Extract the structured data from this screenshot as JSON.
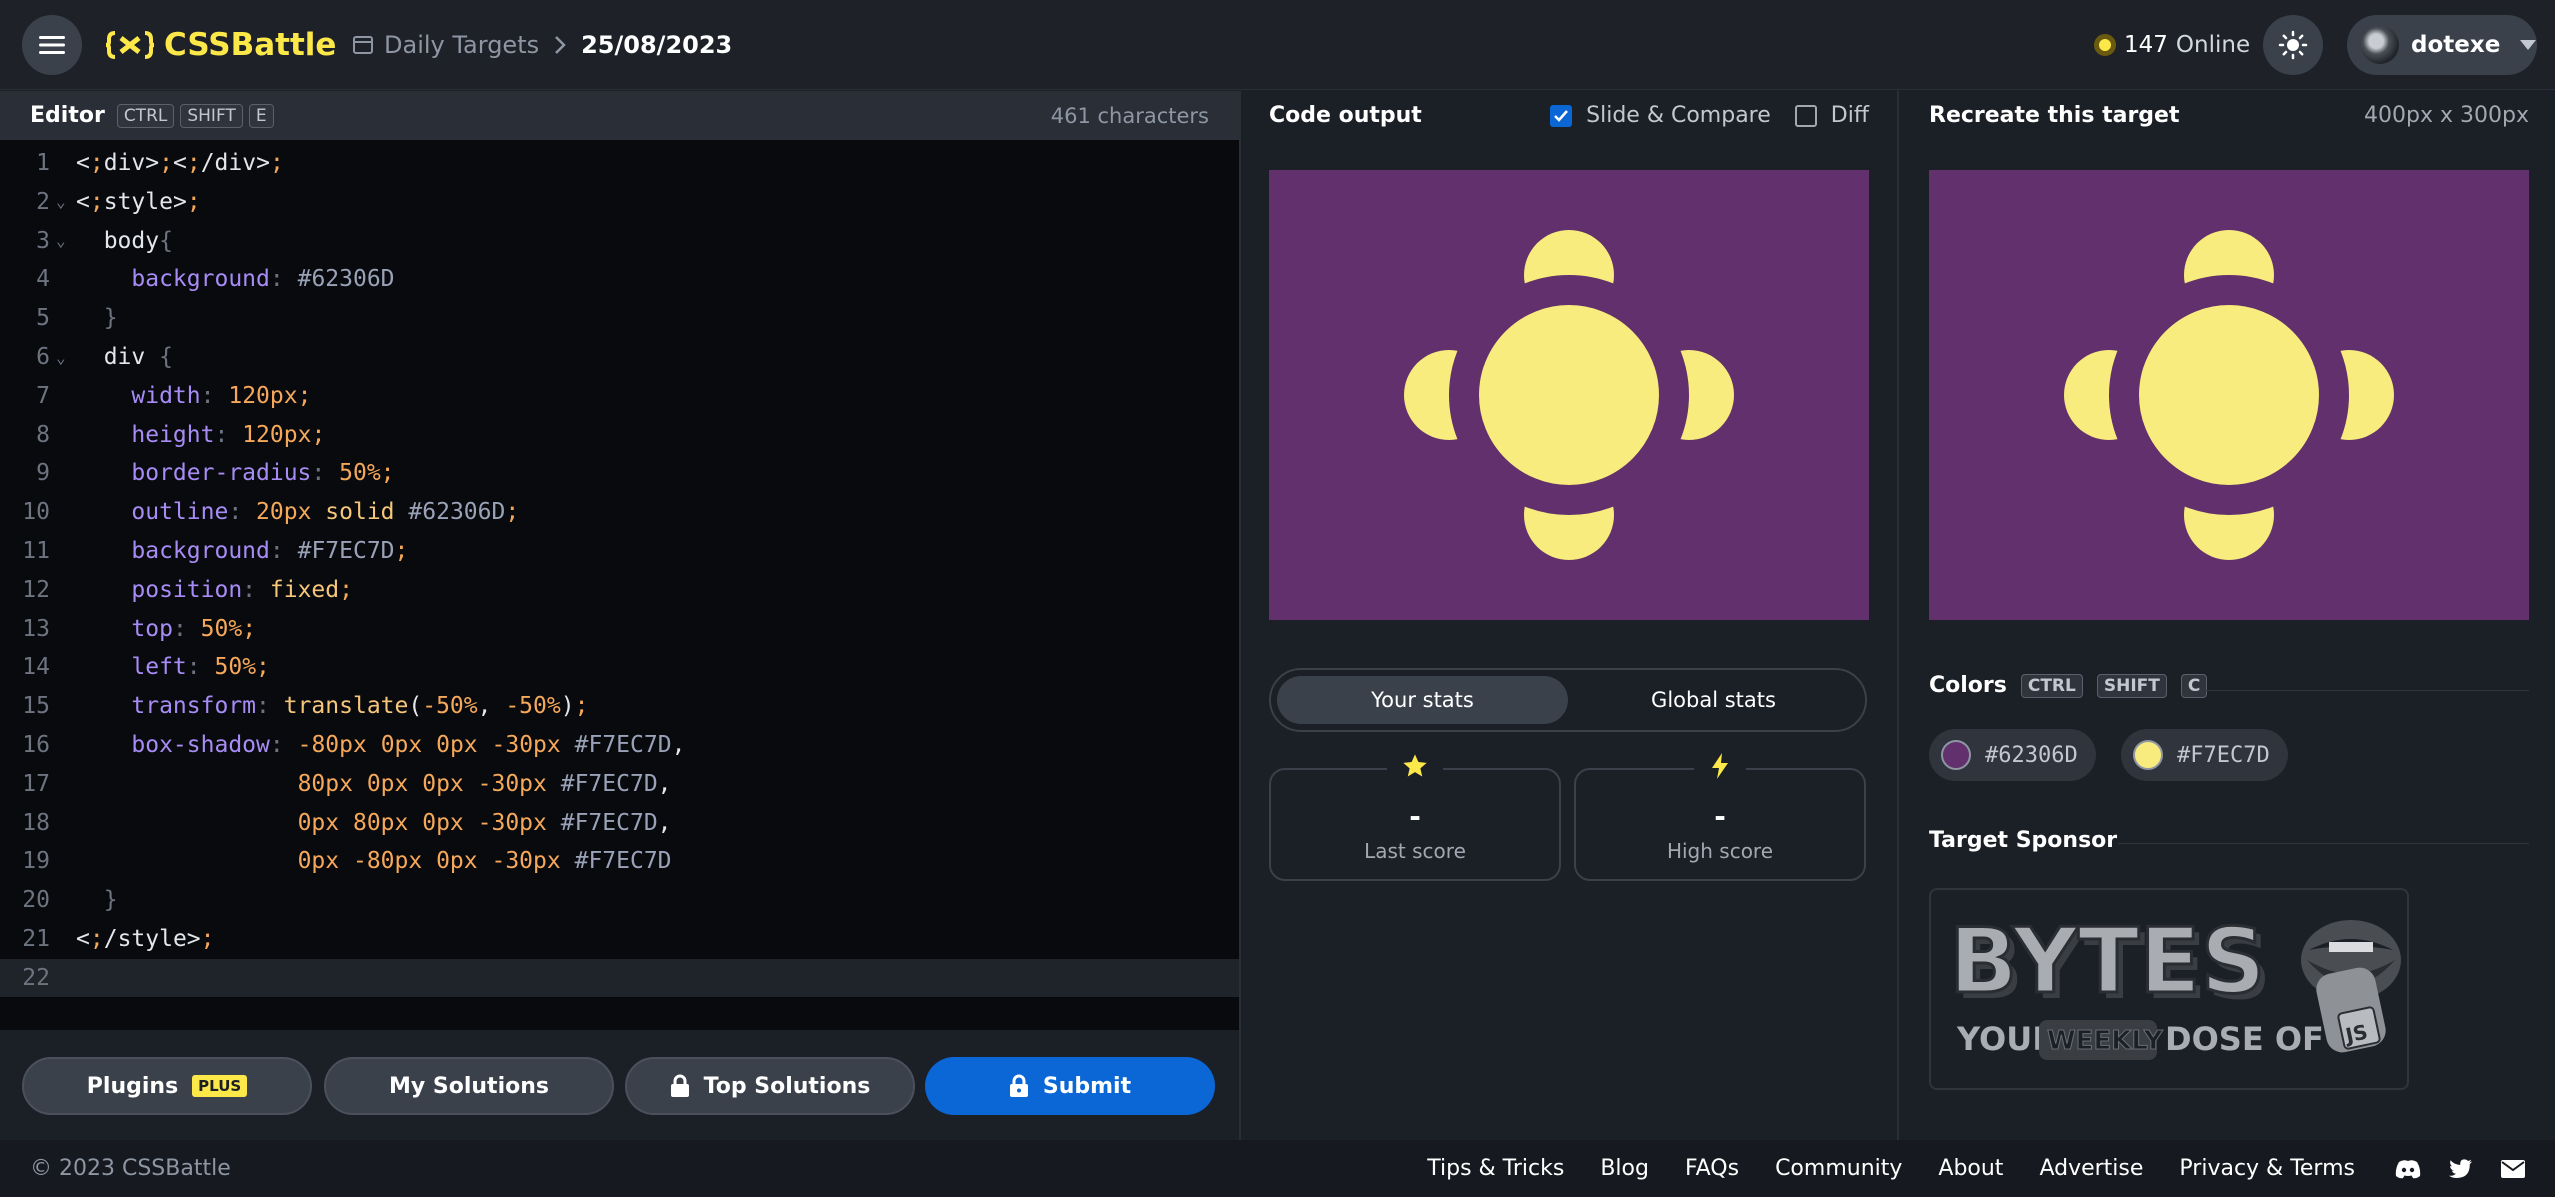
{
  "header": {
    "logo_text": "CSSBattle",
    "breadcrumb_link": "Daily Targets",
    "breadcrumb_date": "25/08/2023",
    "online_count": "147",
    "online_label": "Online",
    "username": "dotexe"
  },
  "editor": {
    "title": "Editor",
    "shortcut": [
      "CTRL",
      "SHIFT",
      "E"
    ],
    "char_count": "461 characters",
    "line_numbers": [
      "1",
      "2",
      "3",
      "4",
      "5",
      "6",
      "7",
      "8",
      "9",
      "10",
      "11",
      "12",
      "13",
      "14",
      "15",
      "16",
      "17",
      "18",
      "19",
      "20",
      "21",
      "22"
    ],
    "lines": [
      "<div></div>",
      "<style>",
      "  body{",
      "    background: #62306D",
      "  }",
      "  div {",
      "    width: 120px;",
      "    height: 120px;",
      "    border-radius: 50%;",
      "    outline: 20px solid #62306D;",
      "    background: #F7EC7D;",
      "    position: fixed;",
      "    top: 50%;",
      "    left: 50%;",
      "    transform: translate(-50%, -50%);",
      "    box-shadow: -80px 0px 0px -30px #F7EC7D,",
      "                80px 0px 0px -30px #F7EC7D,",
      "                0px 80px 0px -30px #F7EC7D,",
      "                0px -80px 0px -30px #F7EC7D",
      "  }",
      "</style>",
      ""
    ]
  },
  "actions": {
    "plugins": "Plugins",
    "plugins_badge": "PLUS",
    "my_solutions": "My Solutions",
    "top_solutions": "Top Solutions",
    "submit": "Submit"
  },
  "output": {
    "title": "Code output",
    "slide_compare": "Slide & Compare",
    "slide_compare_checked": true,
    "diff": "Diff",
    "diff_checked": false
  },
  "stats": {
    "tab_your": "Your stats",
    "tab_global": "Global stats",
    "last_score_value": "-",
    "last_score_label": "Last score",
    "high_score_value": "-",
    "high_score_label": "High score"
  },
  "target": {
    "title": "Recreate this target",
    "size": "400px x 300px",
    "colors_title": "Colors",
    "colors_shortcut": [
      "CTRL",
      "SHIFT",
      "C"
    ],
    "colors": [
      {
        "hex": "#62306D"
      },
      {
        "hex": "#F7EC7D"
      }
    ],
    "sponsor_title": "Target Sponsor",
    "sponsor_line1": "BYTES",
    "sponsor_line2a": "YOUR",
    "sponsor_line2b": "WEEKLY",
    "sponsor_line2c": "DOSE OF",
    "sponsor_js": "JS"
  },
  "footer": {
    "copyright": "© 2023 CSSBattle",
    "links": [
      "Tips & Tricks",
      "Blog",
      "FAQs",
      "Community",
      "About",
      "Advertise",
      "Privacy & Terms"
    ]
  },
  "colors": {
    "accent_yellow": "#fde84a",
    "primary_blue": "#0b66d6",
    "target_bg": "#62306D",
    "target_fg": "#F7EC7D"
  }
}
